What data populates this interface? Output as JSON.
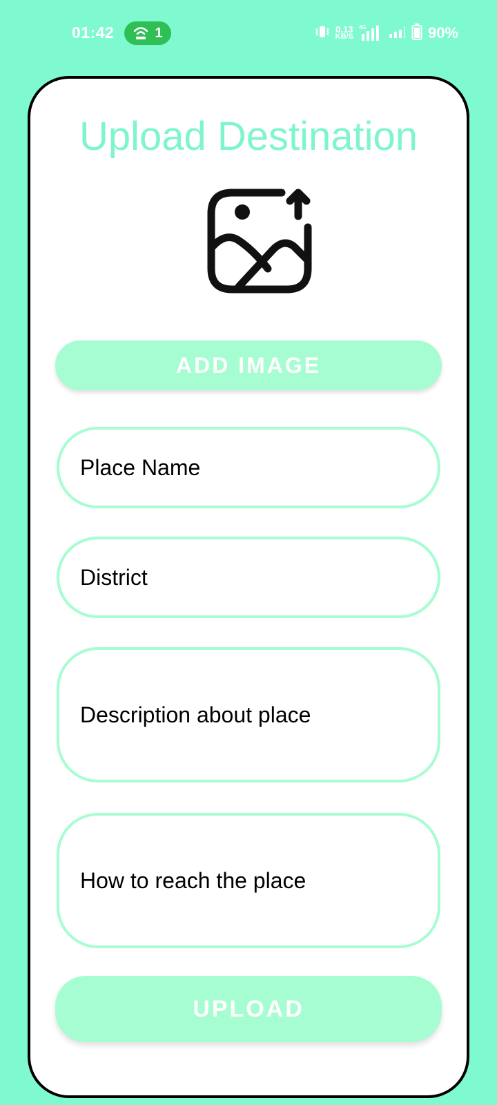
{
  "status_bar": {
    "time": "01:42",
    "hotspot_count": "1",
    "net_speed_value": "0.13",
    "net_speed_unit": "KB/S",
    "network_type": "4G",
    "battery_percent": "90%",
    "icons": [
      "hotspot-icon",
      "vibrate-icon",
      "signal-icon",
      "battery-icon"
    ]
  },
  "page": {
    "title": "Upload Destination",
    "image_icon": "image-upload-icon",
    "add_image_label": "ADD IMAGE",
    "fields": {
      "place_name_placeholder": "Place Name",
      "district_placeholder": "District",
      "description_placeholder": "Description about place",
      "how_to_reach_placeholder": "How to reach the place"
    },
    "upload_label": "UPLOAD"
  },
  "colors": {
    "background": "#7ffad0",
    "accent": "#a6fdd1",
    "title": "#7ff5cd",
    "hotspot_pill": "#2fbf55",
    "card": "#ffffff",
    "card_border": "#000000"
  }
}
